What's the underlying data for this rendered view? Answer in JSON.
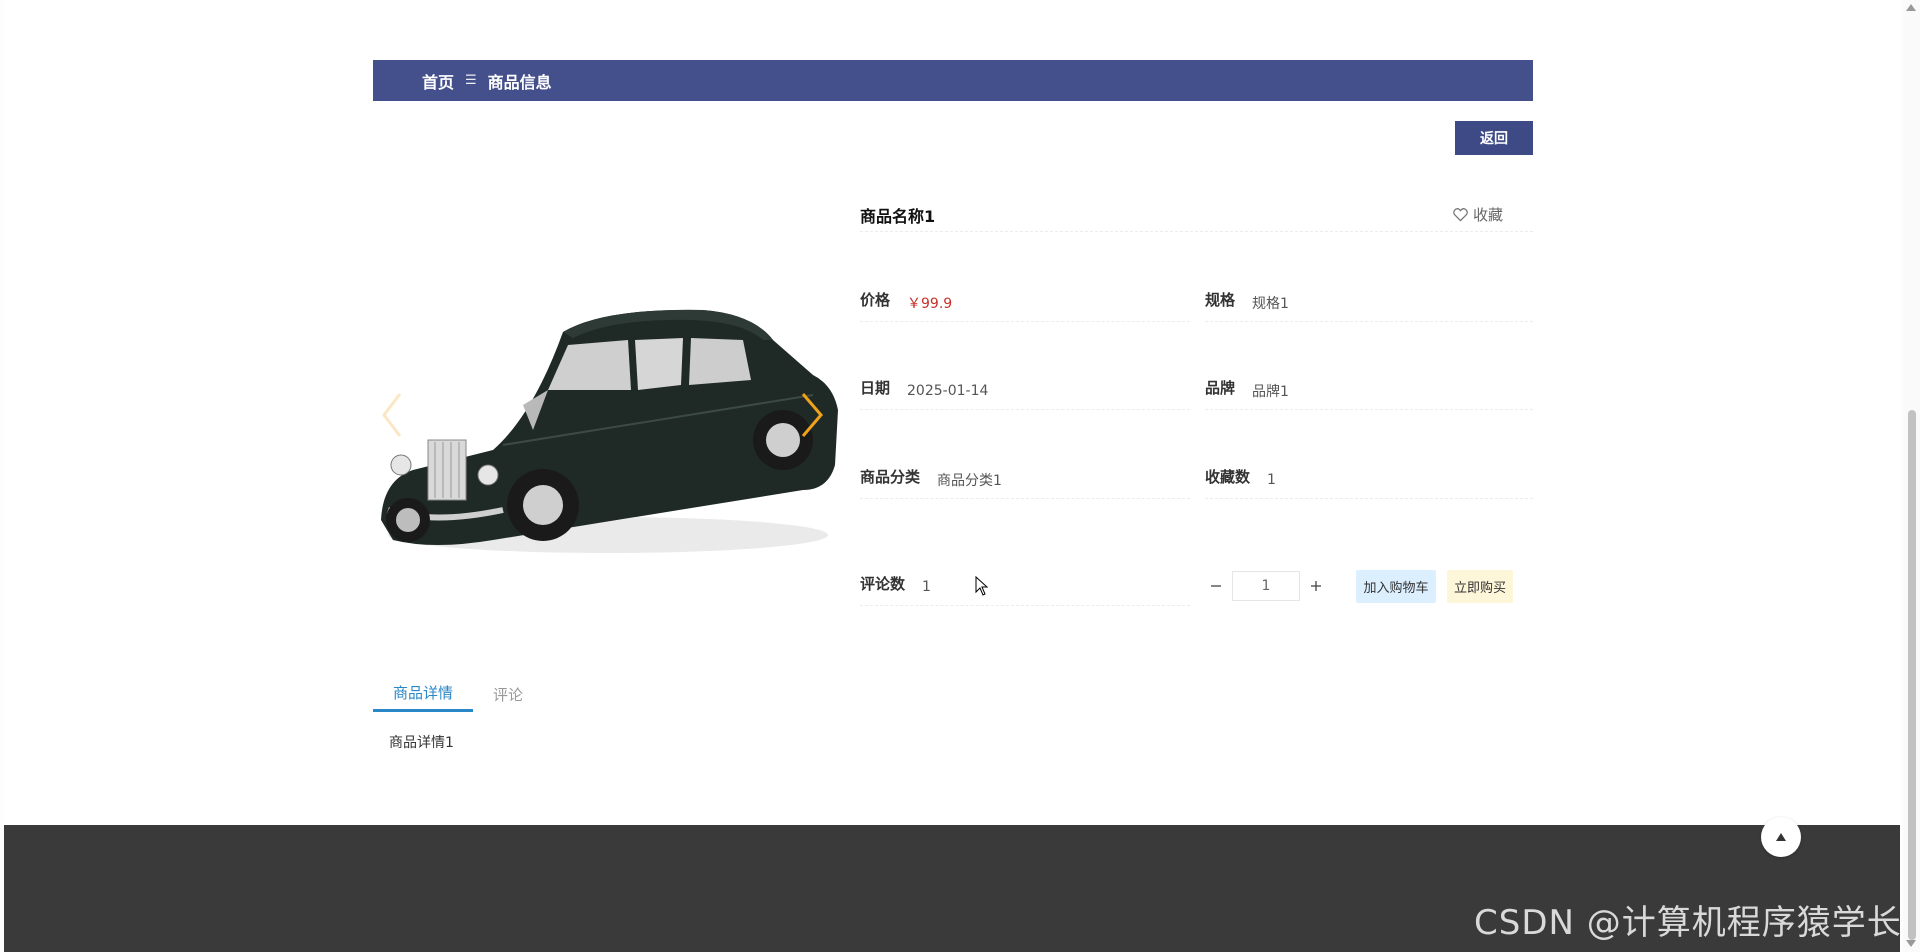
{
  "breadcrumb": {
    "home": "首页",
    "separator": "☰",
    "current": "商品信息"
  },
  "actions": {
    "back_label": "返回"
  },
  "product": {
    "name": "商品名称1",
    "favorite_label": "收藏",
    "fields": {
      "price_label": "价格",
      "price_value": "￥99.9",
      "spec_label": "规格",
      "spec_value": "规格1",
      "date_label": "日期",
      "date_value": "2025-01-14",
      "brand_label": "品牌",
      "brand_value": "品牌1",
      "category_label": "商品分类",
      "category_value": "商品分类1",
      "favorites_label": "收藏数",
      "favorites_value": "1",
      "comments_label": "评论数",
      "comments_value": "1"
    },
    "quantity": "1",
    "add_to_cart_label": "加入购物车",
    "buy_now_label": "立即购买"
  },
  "tabs": [
    {
      "label": "商品详情",
      "active": true
    },
    {
      "label": "评论",
      "active": false
    }
  ],
  "tab_content": "商品详情1",
  "watermark": "CSDN @计算机程序猿学长",
  "colors": {
    "header": "#44508c",
    "price": "#c8302b",
    "tab_active": "#2a87c8",
    "footer": "#3a3a3a"
  },
  "icons": {
    "favorite": "heart-outline-icon",
    "separator": "menu-lines-icon",
    "next": "chevron-right-icon",
    "back_to_top": "triangle-up-icon"
  }
}
